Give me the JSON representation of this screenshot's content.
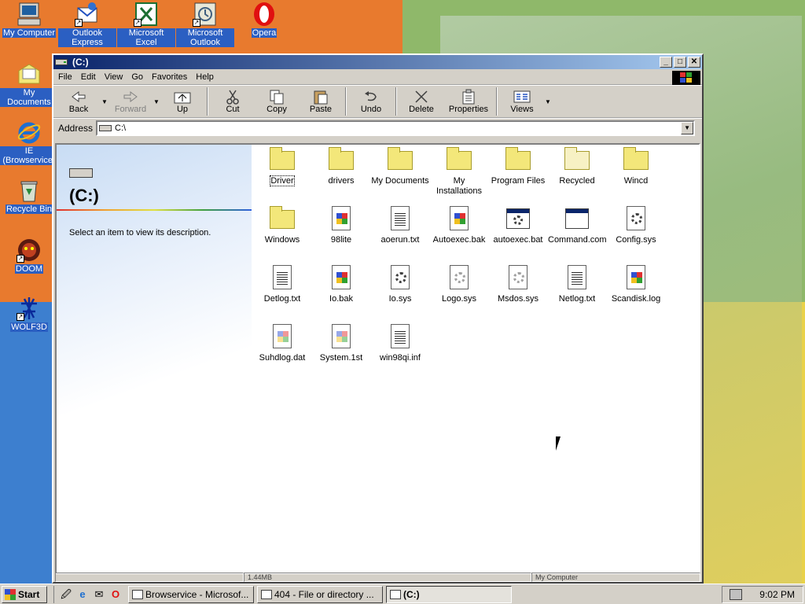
{
  "desktop": {
    "icons": [
      {
        "label": "My Computer",
        "icon": "my-computer-icon"
      },
      {
        "label": "Outlook Express",
        "icon": "outlook-express-icon"
      },
      {
        "label": "Microsoft Excel",
        "icon": "excel-icon"
      },
      {
        "label": "Microsoft Outlook",
        "icon": "outlook-icon"
      },
      {
        "label": "Opera",
        "icon": "opera-icon"
      },
      {
        "label": "My Documents",
        "icon": "my-documents-icon"
      },
      {
        "label": "IE (Browservice)",
        "icon": "internet-explorer-icon"
      },
      {
        "label": "Recycle Bin",
        "icon": "recycle-bin-icon"
      },
      {
        "label": "DOOM",
        "icon": "doom-icon"
      },
      {
        "label": "WOLF3D",
        "icon": "wolf3d-icon"
      }
    ]
  },
  "window": {
    "title": "(C:)",
    "menu": [
      "File",
      "Edit",
      "View",
      "Go",
      "Favorites",
      "Help"
    ],
    "toolbar": {
      "back": "Back",
      "forward": "Forward",
      "up": "Up",
      "cut": "Cut",
      "copy": "Copy",
      "paste": "Paste",
      "undo": "Undo",
      "delete": "Delete",
      "properties": "Properties",
      "views": "Views"
    },
    "address": {
      "label": "Address",
      "value": "C:\\"
    },
    "left_pane": {
      "drive_title": "(C:)",
      "description": "Select an item to view its description."
    },
    "files": [
      {
        "name": "Driver",
        "type": "folder"
      },
      {
        "name": "drivers",
        "type": "folder"
      },
      {
        "name": "My Documents",
        "type": "folder"
      },
      {
        "name": "My Installations",
        "type": "folder"
      },
      {
        "name": "Program Files",
        "type": "folder"
      },
      {
        "name": "Recycled",
        "type": "folder-hidden"
      },
      {
        "name": "Wincd",
        "type": "folder"
      },
      {
        "name": "Windows",
        "type": "folder"
      },
      {
        "name": "98lite",
        "type": "flag-doc"
      },
      {
        "name": "aoerun.txt",
        "type": "text-doc"
      },
      {
        "name": "Autoexec.bak",
        "type": "flag-doc"
      },
      {
        "name": "autoexec.bat",
        "type": "batch"
      },
      {
        "name": "Command.com",
        "type": "app"
      },
      {
        "name": "Config.sys",
        "type": "gear-doc"
      },
      {
        "name": "Detlog.txt",
        "type": "text-doc"
      },
      {
        "name": "Io.bak",
        "type": "flag-doc"
      },
      {
        "name": "Io.sys",
        "type": "gear-doc"
      },
      {
        "name": "Logo.sys",
        "type": "gear-doc-faded"
      },
      {
        "name": "Msdos.sys",
        "type": "gear-doc-faded"
      },
      {
        "name": "Netlog.txt",
        "type": "text-doc"
      },
      {
        "name": "Scandisk.log",
        "type": "flag-doc"
      },
      {
        "name": "Suhdlog.dat",
        "type": "flag-doc-faded"
      },
      {
        "name": "System.1st",
        "type": "flag-doc-faded"
      },
      {
        "name": "win98qi.inf",
        "type": "text-doc"
      }
    ],
    "status": {
      "size": "1.44MB",
      "zone": "My Computer"
    }
  },
  "taskbar": {
    "start": "Start",
    "tasks": [
      {
        "label": "Browservice - Microsof...",
        "active": false
      },
      {
        "label": "404 - File or directory ...",
        "active": false
      },
      {
        "label": "(C:)",
        "active": true
      }
    ],
    "clock": "9:02 PM"
  }
}
